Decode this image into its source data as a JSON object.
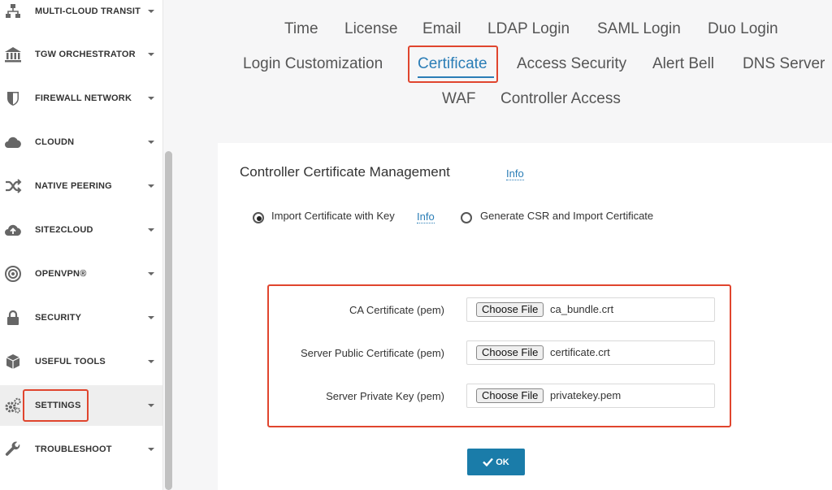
{
  "sidebar": {
    "items": [
      {
        "label": "MULTI-CLOUD TRANSIT",
        "icon": "network-tree-icon"
      },
      {
        "label": "TGW ORCHESTRATOR",
        "icon": "bank-building-icon"
      },
      {
        "label": "FIREWALL NETWORK",
        "icon": "shield-icon"
      },
      {
        "label": "CLOUDN",
        "icon": "cloud-icon"
      },
      {
        "label": "NATIVE PEERING",
        "icon": "shuffle-arrows-icon"
      },
      {
        "label": "SITE2CLOUD",
        "icon": "cloud-upload-icon"
      },
      {
        "label": "OPENVPN®",
        "icon": "target-circle-icon"
      },
      {
        "label": "SECURITY",
        "icon": "lock-icon"
      },
      {
        "label": "USEFUL TOOLS",
        "icon": "cube-icon"
      },
      {
        "label": "SETTINGS",
        "icon": "gears-icon"
      },
      {
        "label": "TROUBLESHOOT",
        "icon": "wrench-icon"
      }
    ],
    "active": "SETTINGS"
  },
  "tabs": {
    "row1": [
      "Time",
      "License",
      "Email",
      "LDAP Login",
      "SAML Login",
      "Duo Login"
    ],
    "row2": [
      "Login Customization",
      "Certificate",
      "Access Security",
      "Alert Bell",
      "DNS Server"
    ],
    "row3": [
      "WAF",
      "Controller Access"
    ],
    "active": "Certificate"
  },
  "card": {
    "title": "Controller Certificate Management",
    "title_info": "Info",
    "options": {
      "import_label": "Import Certificate with Key",
      "import_info": "Info",
      "csr_label": "Generate CSR and Import Certificate",
      "selected": "Import Certificate with Key"
    },
    "fields": [
      {
        "label": "CA Certificate (pem)",
        "button": "Choose File",
        "file": "ca_bundle.crt"
      },
      {
        "label": "Server Public Certificate (pem)",
        "button": "Choose File",
        "file": "certificate.crt"
      },
      {
        "label": "Server Private Key (pem)",
        "button": "Choose File",
        "file": "privatekey.pem"
      }
    ],
    "ok_label": "OK"
  },
  "colors": {
    "accent": "#2a7db6",
    "ok_button": "#1a7ca9",
    "highlight": "#e0452e"
  }
}
